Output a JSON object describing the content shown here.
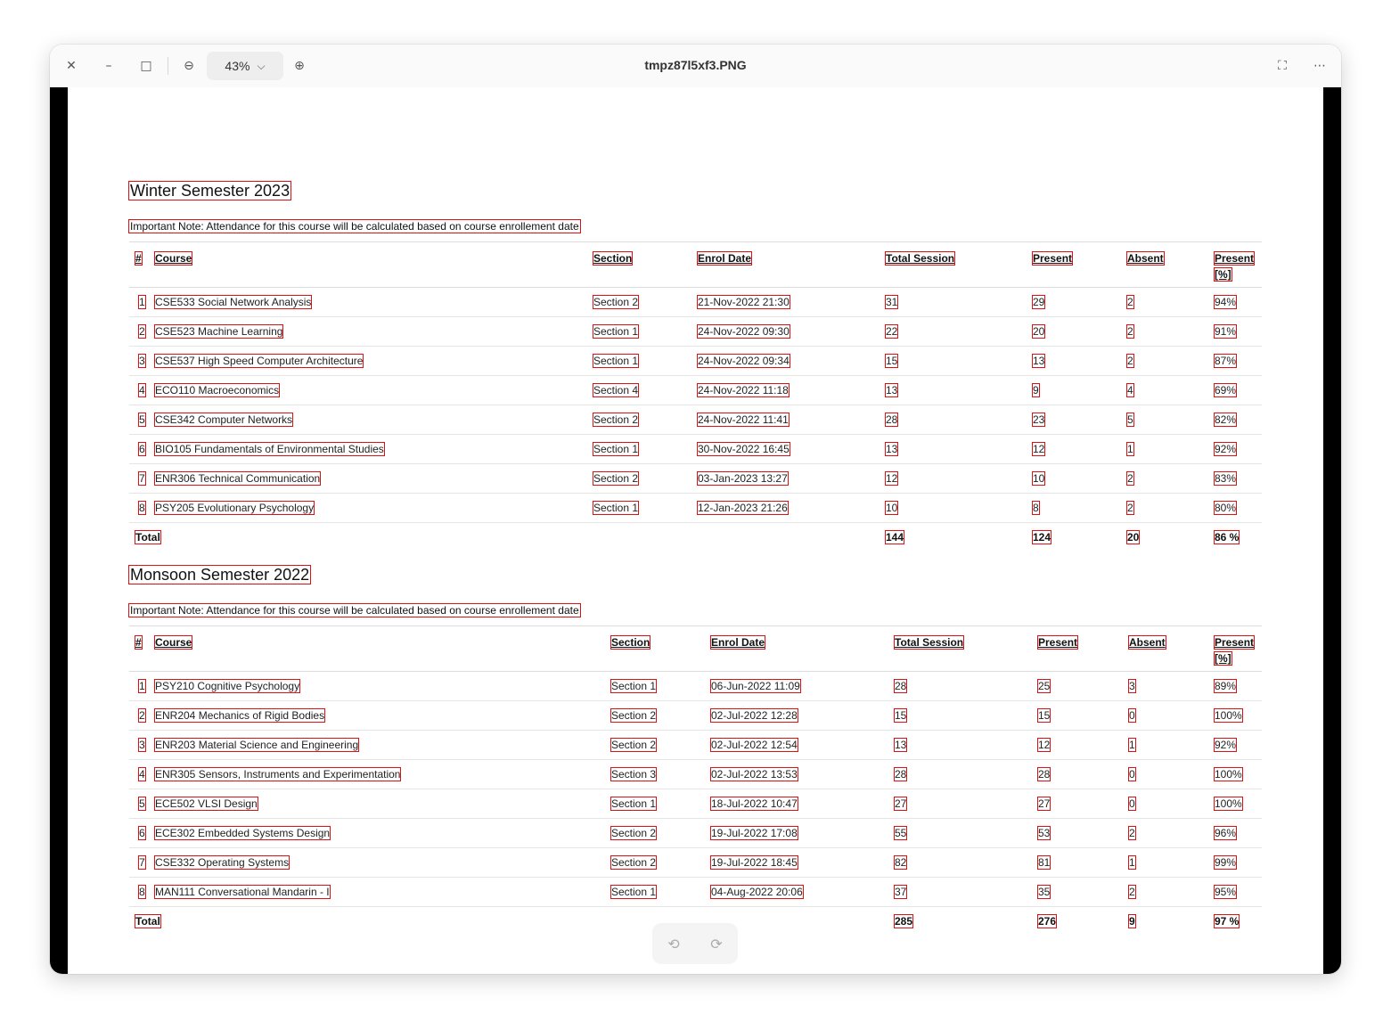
{
  "window": {
    "title": "tmpz87l5xf3.PNG",
    "zoom": "43%",
    "icons": {
      "close": "✕",
      "minimize": "–",
      "maximize": "□",
      "zoom_out": "⊖",
      "zoom_in": "⊕",
      "chevron": "⌵",
      "fullscreen": "⛶",
      "more": "⋯",
      "rotate_left": "⟲",
      "rotate_right": "⟳"
    }
  },
  "winter": {
    "title": "Winter Semester 2023",
    "note": "Important Note: Attendance for this course will be calculated based on course enrollement date",
    "headers": {
      "num": "#",
      "course": "Course",
      "section": "Section",
      "enrol": "Enrol Date",
      "total": "Total Session",
      "present": "Present",
      "absent": "Absent",
      "pct1": "Present",
      "pct2": "[%]"
    },
    "rows": [
      {
        "n": "1",
        "course": "CSE533 Social Network Analysis",
        "section": "Section 2",
        "enrol": "21-Nov-2022 21:30",
        "total": "31",
        "present": "29",
        "absent": "2",
        "pct": "94%"
      },
      {
        "n": "2",
        "course": "CSE523 Machine Learning",
        "section": "Section 1",
        "enrol": "24-Nov-2022 09:30",
        "total": "22",
        "present": "20",
        "absent": "2",
        "pct": "91%"
      },
      {
        "n": "3",
        "course": "CSE537 High Speed Computer Architecture",
        "section": "Section 1",
        "enrol": "24-Nov-2022 09:34",
        "total": "15",
        "present": "13",
        "absent": "2",
        "pct": "87%"
      },
      {
        "n": "4",
        "course": "ECO110 Macroeconomics",
        "section": "Section 4",
        "enrol": "24-Nov-2022 11:18",
        "total": "13",
        "present": "9",
        "absent": "4",
        "pct": "69%"
      },
      {
        "n": "5",
        "course": "CSE342 Computer Networks",
        "section": "Section 2",
        "enrol": "24-Nov-2022 11:41",
        "total": "28",
        "present": "23",
        "absent": "5",
        "pct": "82%"
      },
      {
        "n": "6",
        "course": "BIO105 Fundamentals of Environmental Studies",
        "section": "Section 1",
        "enrol": "30-Nov-2022 16:45",
        "total": "13",
        "present": "12",
        "absent": "1",
        "pct": "92%"
      },
      {
        "n": "7",
        "course": "ENR306 Technical Communication",
        "section": "Section 2",
        "enrol": "03-Jan-2023 13:27",
        "total": "12",
        "present": "10",
        "absent": "2",
        "pct": "83%"
      },
      {
        "n": "8",
        "course": "PSY205 Evolutionary Psychology",
        "section": "Section 1",
        "enrol": "12-Jan-2023 21:26",
        "total": "10",
        "present": "8",
        "absent": "2",
        "pct": "80%"
      }
    ],
    "total": {
      "label": "Total",
      "total": "144",
      "present": "124",
      "absent": "20",
      "pct": "86 %"
    }
  },
  "monsoon": {
    "title": "Monsoon Semester 2022",
    "note": "Important Note: Attendance for this course will be calculated based on course enrollement date",
    "headers": {
      "num": "#",
      "course": "Course",
      "section": "Section",
      "enrol": "Enrol Date",
      "total": "Total Session",
      "present": "Present",
      "absent": "Absent",
      "pct1": "Present",
      "pct2": "[%]"
    },
    "rows": [
      {
        "n": "1",
        "course": "PSY210 Cognitive Psychology",
        "section": "Section 1",
        "enrol": "06-Jun-2022 11:09",
        "total": "28",
        "present": "25",
        "absent": "3",
        "pct": "89%"
      },
      {
        "n": "2",
        "course": "ENR204 Mechanics of Rigid Bodies",
        "section": "Section 2",
        "enrol": "02-Jul-2022 12:28",
        "total": "15",
        "present": "15",
        "absent": "0",
        "pct": "100%"
      },
      {
        "n": "3",
        "course": "ENR203 Material Science and Engineering",
        "section": "Section 2",
        "enrol": "02-Jul-2022 12:54",
        "total": "13",
        "present": "12",
        "absent": "1",
        "pct": "92%"
      },
      {
        "n": "4",
        "course": "ENR305 Sensors, Instruments and Experimentation",
        "section": "Section 3",
        "enrol": "02-Jul-2022 13:53",
        "total": "28",
        "present": "28",
        "absent": "0",
        "pct": "100%"
      },
      {
        "n": "5",
        "course": "ECE502 VLSI Design",
        "section": "Section 1",
        "enrol": "18-Jul-2022 10:47",
        "total": "27",
        "present": "27",
        "absent": "0",
        "pct": "100%"
      },
      {
        "n": "6",
        "course": "ECE302 Embedded Systems Design",
        "section": "Section 2",
        "enrol": "19-Jul-2022 17:08",
        "total": "55",
        "present": "53",
        "absent": "2",
        "pct": "96%"
      },
      {
        "n": "7",
        "course": "CSE332 Operating Systems",
        "section": "Section 2",
        "enrol": "19-Jul-2022 18:45",
        "total": "82",
        "present": "81",
        "absent": "1",
        "pct": "99%"
      },
      {
        "n": "8",
        "course": "MAN111 Conversational Mandarin - I",
        "section": "Section 1",
        "enrol": "04-Aug-2022 20:06",
        "total": "37",
        "present": "35",
        "absent": "2",
        "pct": "95%"
      }
    ],
    "total": {
      "label": "Total",
      "total": "285",
      "present": "276",
      "absent": "9",
      "pct": "97 %"
    }
  }
}
